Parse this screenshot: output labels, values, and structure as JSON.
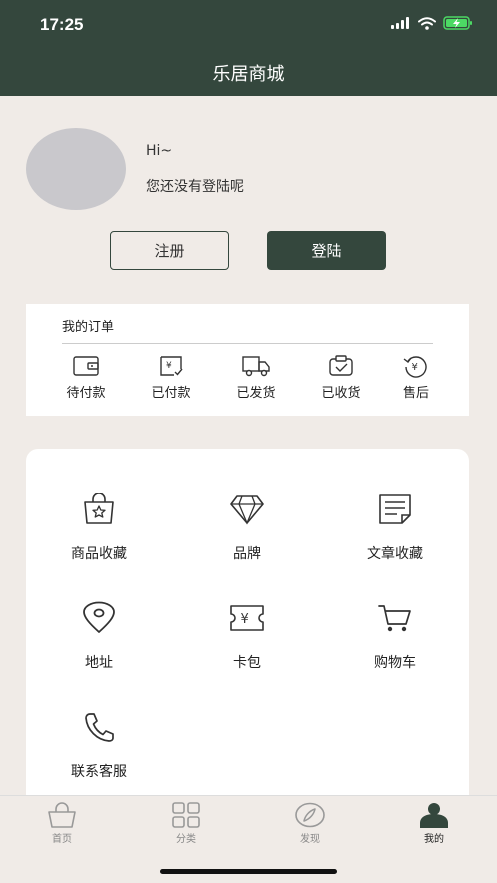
{
  "status_bar": {
    "time": "17:25"
  },
  "header": {
    "title": "乐居商城"
  },
  "profile": {
    "greeting": "Hi~",
    "login_hint": "您还没有登陆呢"
  },
  "buttons": {
    "register": "注册",
    "login": "登陆"
  },
  "orders": {
    "title": "我的订单",
    "items": [
      {
        "label": "待付款",
        "icon": "wallet-icon"
      },
      {
        "label": "已付款",
        "icon": "paid-receipt-icon"
      },
      {
        "label": "已发货",
        "icon": "truck-icon"
      },
      {
        "label": "已收货",
        "icon": "received-box-icon"
      },
      {
        "label": "售后",
        "icon": "refund-icon"
      }
    ]
  },
  "services": [
    {
      "label": "商品收藏",
      "icon": "favorite-bag-icon"
    },
    {
      "label": "品牌",
      "icon": "diamond-icon"
    },
    {
      "label": "文章收藏",
      "icon": "article-icon"
    },
    {
      "label": "地址",
      "icon": "location-icon"
    },
    {
      "label": "卡包",
      "icon": "coupon-icon"
    },
    {
      "label": "购物车",
      "icon": "cart-icon"
    },
    {
      "label": "联系客服",
      "icon": "phone-icon"
    }
  ],
  "tabbar": [
    {
      "label": "首页",
      "icon": "home-basket-icon",
      "active": false
    },
    {
      "label": "分类",
      "icon": "category-grid-icon",
      "active": false
    },
    {
      "label": "发现",
      "icon": "discover-compass-icon",
      "active": false
    },
    {
      "label": "我的",
      "icon": "profile-icon",
      "active": true
    }
  ],
  "colors": {
    "primary": "#34473d",
    "background": "#f0ebe7",
    "card": "#ffffff",
    "avatar": "#c9c8cc",
    "battery": "#4cd964"
  }
}
